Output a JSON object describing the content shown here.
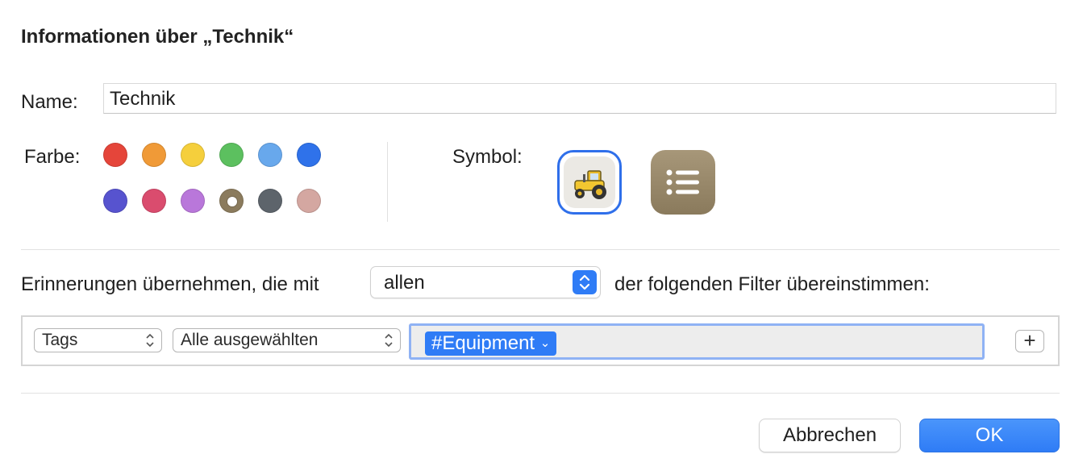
{
  "dialog": {
    "title": "Informationen über „Technik“"
  },
  "name": {
    "label": "Name:",
    "value": "Technik"
  },
  "color": {
    "label": "Farbe:",
    "swatches": [
      "#e5453a",
      "#f09a37",
      "#f5cf3c",
      "#5cc05f",
      "#68a8ec",
      "#2f72ea",
      "#5753cf",
      "#da4c6e",
      "#b977da",
      "#8b7b5d",
      "#5d646b",
      "#d4a7a1"
    ],
    "selected_color": "#8b7b5d"
  },
  "symbol": {
    "label": "Symbol:",
    "options": [
      "tractor-icon",
      "list-bullet-icon"
    ],
    "selected": "tractor-icon"
  },
  "filter_rule": {
    "prefix": "Erinnerungen übernehmen, die mit",
    "match_value": "allen",
    "suffix": "der folgenden Filter übereinstimmen:"
  },
  "filter_row": {
    "field": "Tags",
    "operator": "Alle ausgewählten",
    "token": "#Equipment"
  },
  "buttons": {
    "cancel": "Abbrechen",
    "ok": "OK"
  }
}
